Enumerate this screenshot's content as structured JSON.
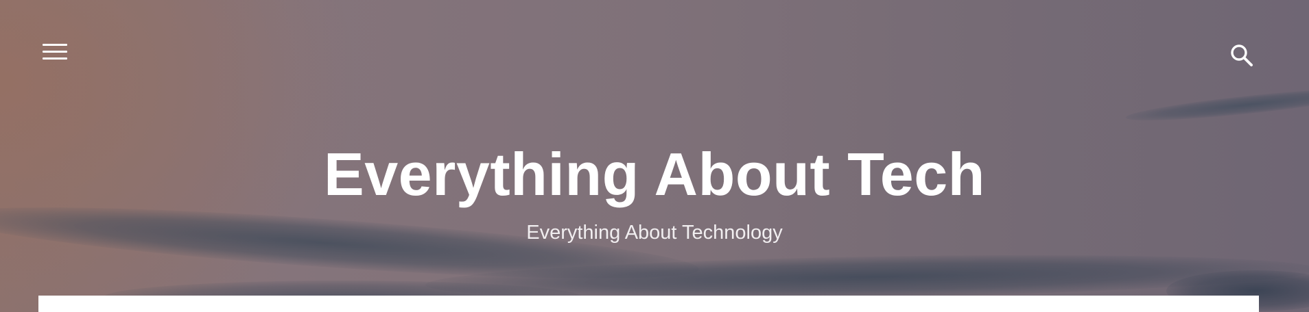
{
  "header": {
    "menu_icon": "hamburger-menu-icon",
    "search_icon": "search-icon"
  },
  "site": {
    "title": "Everything About Tech",
    "description": "Everything About Technology"
  },
  "colors": {
    "text": "#ffffff",
    "tagline": "#f1eef0",
    "card": "#ffffff",
    "sky_left": "#8b7270",
    "sky_right": "#6f6674"
  }
}
